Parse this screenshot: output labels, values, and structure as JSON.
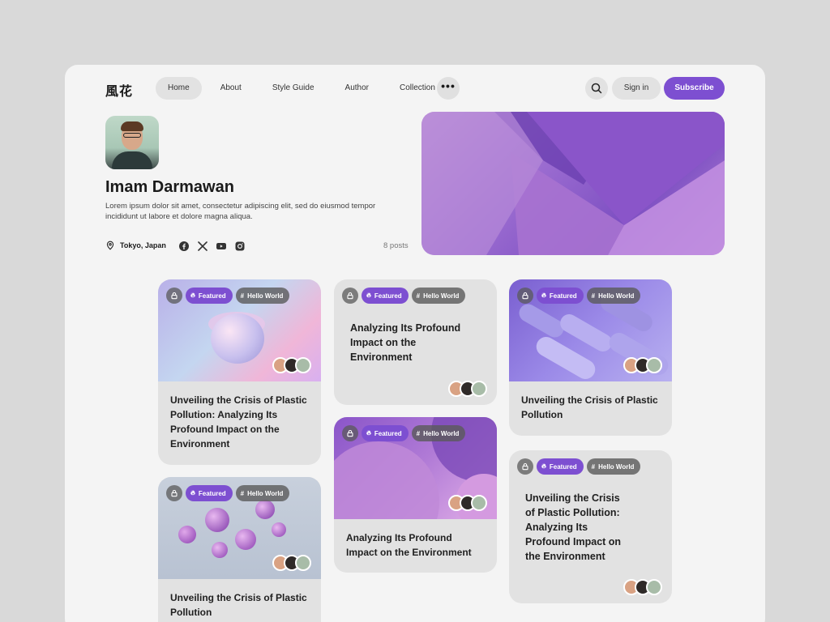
{
  "nav": {
    "logo": "風花",
    "items": [
      "Home",
      "About",
      "Style Guide",
      "Author",
      "Collection"
    ],
    "more": "•••",
    "signin": "Sign in",
    "subscribe": "Subscribe"
  },
  "profile": {
    "name": "Imam Darmawan",
    "bio": "Lorem ipsum dolor sit amet, consectetur adipiscing elit, sed do eiusmod tempor incididunt ut labore et dolore magna aliqua.",
    "location": "Tokyo, Japan",
    "posts": "8 posts",
    "socials": [
      "facebook-icon",
      "x-icon",
      "youtube-icon",
      "instagram-icon"
    ]
  },
  "tags": {
    "featured": "Featured",
    "hello": "Hello World"
  },
  "cards": [
    {
      "title": "Unveiling the Crisis of Plastic Pollution: Analyzing Its Profound Impact on the Environment"
    },
    {
      "title": "Unveiling the Crisis of Plastic Pollution"
    },
    {
      "title": "Analyzing Its Profound Impact on the Environment"
    },
    {
      "title": "Analyzing Its Profound Impact on the Environment"
    },
    {
      "title": "Unveiling the Crisis of Plastic Pollution"
    },
    {
      "title": "Unveiling the Crisis of Plastic Pollution: Analyzing Its Profound Impact on the Environment"
    }
  ],
  "colors": {
    "accent": "#7d4fd1",
    "panel": "#f4f4f4",
    "card": "#e2e2e2"
  }
}
